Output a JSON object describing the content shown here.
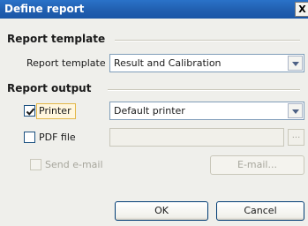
{
  "window": {
    "title": "Define report",
    "close_glyph": "X"
  },
  "template_section": {
    "heading": "Report template",
    "label": "Report template",
    "selected": "Result and Calibration"
  },
  "output_section": {
    "heading": "Report output",
    "printer": {
      "label": "Printer",
      "checked": true,
      "selected": "Default printer"
    },
    "pdf": {
      "label": "PDF file",
      "checked": false,
      "value": "",
      "browse_label": "..."
    },
    "email": {
      "label": "Send e-mail",
      "checked": false,
      "button_label": "E-mail..."
    }
  },
  "buttons": {
    "ok": "OK",
    "cancel": "Cancel"
  },
  "icons": {
    "dropdown": "chevron-down-icon",
    "checkmark": "checkmark-icon",
    "close": "close-icon"
  }
}
